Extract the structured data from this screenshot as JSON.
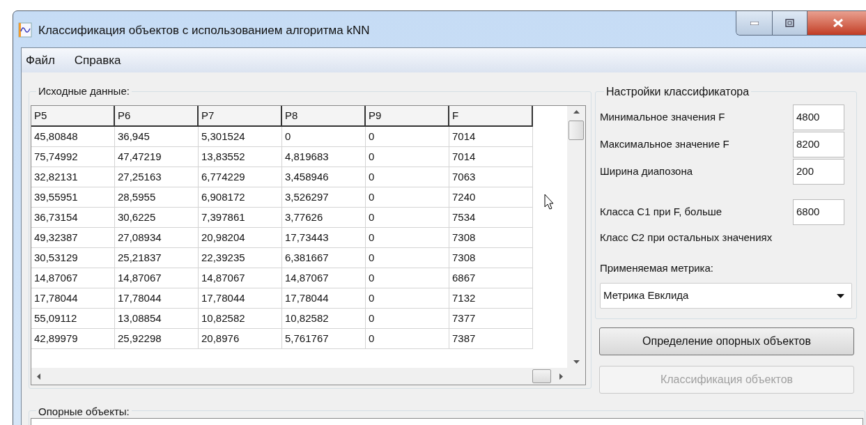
{
  "window": {
    "title": "Классификация объектов с использованием алгоритма kNN"
  },
  "menu": [
    "Файл",
    "Справка"
  ],
  "source_data": {
    "title": "Исходные данные:",
    "columns": [
      "P5",
      "P6",
      "P7",
      "P8",
      "P9",
      "F"
    ],
    "rows": [
      [
        "45,80848",
        "36,945",
        "5,301524",
        "0",
        "0",
        "7014"
      ],
      [
        "75,74992",
        "47,47219",
        "13,83552",
        "4,819683",
        "0",
        "7014"
      ],
      [
        "32,82131",
        "27,25163",
        "6,774229",
        "3,458946",
        "0",
        "7063"
      ],
      [
        "39,55951",
        "28,5955",
        "6,908172",
        "3,526297",
        "0",
        "7240"
      ],
      [
        "36,73154",
        "30,6225",
        "7,397861",
        "3,77626",
        "0",
        "7534"
      ],
      [
        "49,32387",
        "27,08934",
        "20,98204",
        "17,73443",
        "0",
        "7308"
      ],
      [
        "30,53129",
        "25,21837",
        "22,39235",
        "6,381667",
        "0",
        "7308"
      ],
      [
        "14,87067",
        "14,87067",
        "14,87067",
        "14,87067",
        "0",
        "6867"
      ],
      [
        "17,78044",
        "17,78044",
        "17,78044",
        "17,78044",
        "0",
        "7132"
      ],
      [
        "55,09112",
        "13,08854",
        "10,82582",
        "10,82582",
        "0",
        "7377"
      ],
      [
        "42,89979",
        "25,92298",
        "20,8976",
        "5,761767",
        "0",
        "7387"
      ]
    ]
  },
  "settings": {
    "title": "Настройки классификатора",
    "fields": [
      {
        "label": "Минимальное значения F",
        "value": "4800"
      },
      {
        "label": "Максимальное значение F",
        "value": "8200"
      },
      {
        "label": "Ширина диапозона",
        "value": "200"
      },
      {
        "label": "Класса С1 при F, больше",
        "value": "6800"
      }
    ],
    "note": "Класс С2 при остальных значениях",
    "metric_label": "Применяемая метрика:",
    "metric": "Метрика Евклида"
  },
  "buttons": [
    {
      "label": "Определение опорных объектов",
      "disabled": false
    },
    {
      "label": "Классификация объектов",
      "disabled": true
    }
  ],
  "reference_objects": {
    "title": "Опорные объекты:"
  }
}
